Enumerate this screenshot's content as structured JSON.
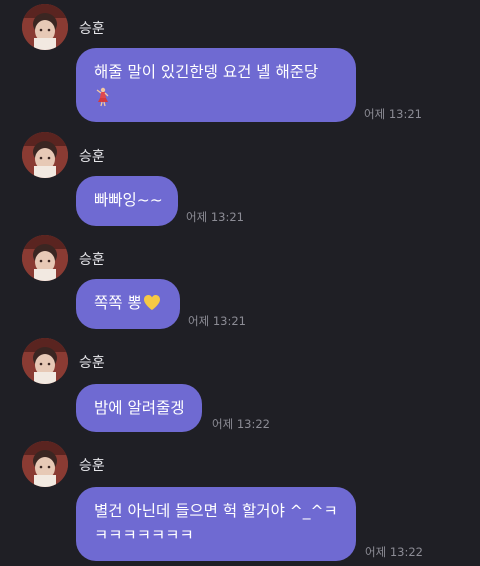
{
  "messages": [
    {
      "sender": "승훈",
      "lines": [
        "해줄 말이 있긴한뎅 요건 녤 해준당"
      ],
      "emoji": "dancer-emoji",
      "time": "어제 13:21"
    },
    {
      "sender": "승훈",
      "lines": [
        "빠빠잉~~"
      ],
      "time": "어제 13:21"
    },
    {
      "sender": "승훈",
      "lines": [
        "쪽쪽 뽕"
      ],
      "emoji": "yellow-heart-emoji",
      "time": "어제 13:21"
    },
    {
      "sender": "승훈",
      "lines": [
        "밤에 알려줄겡"
      ],
      "time": "어제 13:22"
    },
    {
      "sender": "승훈",
      "lines": [
        "별건 아닌데 들으면 헉 할거야 ^_^ㅋ",
        "ㅋㅋㅋㅋㅋㅋㅋ"
      ],
      "time": "어제 13:22"
    }
  ],
  "colors": {
    "background": "#1f1f25",
    "bubble": "#6f6ad2",
    "timestamp": "#8c8c95"
  }
}
